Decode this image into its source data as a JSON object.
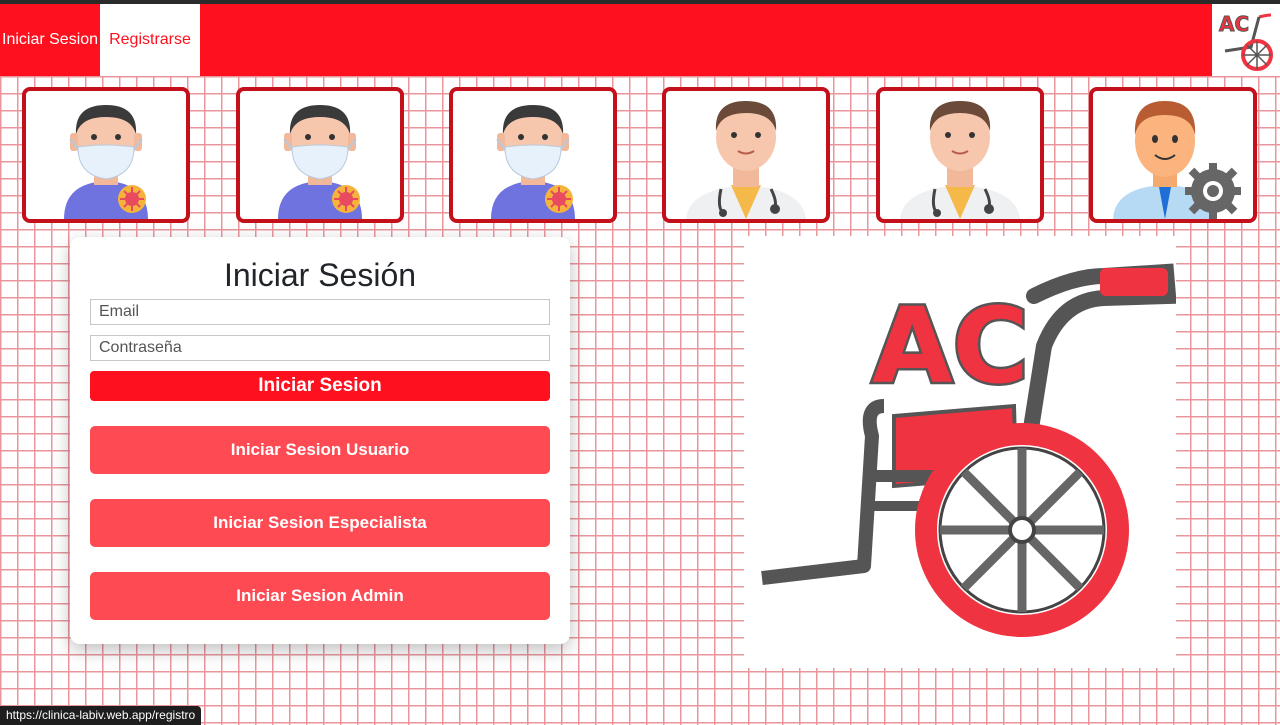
{
  "nav": {
    "login_label": "Iniciar Sesion",
    "register_label": "Registrarse",
    "logo_text": "AC"
  },
  "avatars": [
    {
      "role": "user",
      "icon": "patient-mask-icon"
    },
    {
      "role": "user",
      "icon": "patient-mask-icon"
    },
    {
      "role": "user",
      "icon": "patient-mask-icon"
    },
    {
      "role": "specialist",
      "icon": "doctor-icon"
    },
    {
      "role": "specialist",
      "icon": "doctor-icon"
    },
    {
      "role": "admin",
      "icon": "admin-gear-icon"
    }
  ],
  "login": {
    "title": "Iniciar Sesión",
    "email_placeholder": "Email",
    "password_placeholder": "Contraseña",
    "submit_label": "Iniciar Sesion",
    "user_button": "Iniciar Sesion Usuario",
    "specialist_button": "Iniciar Sesion Especialista",
    "admin_button": "Iniciar Sesion Admin"
  },
  "logo": {
    "text": "AC"
  },
  "status_bar": {
    "url": "https://clinica-labiv.web.app/registro"
  },
  "colors": {
    "brand_red": "#ff101f",
    "role_button": "#fe4a52",
    "card_border": "#c4101b"
  }
}
